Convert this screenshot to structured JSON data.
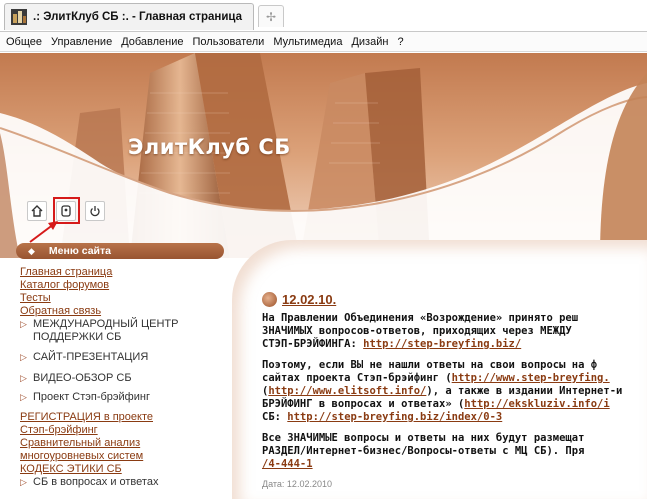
{
  "browser": {
    "tab_title": ".: ЭлитКлуб СБ :. - Главная страница",
    "new_tab_icon": "plus-icon"
  },
  "menu": [
    "Общее",
    "Управление",
    "Добавление",
    "Пользователи",
    "Мультимедиа",
    "Дизайн",
    "?"
  ],
  "site": {
    "title": "ЭлитКлуб СБ",
    "sitemenu_label": "Меню сайта"
  },
  "nav": {
    "l1": "Главная страница",
    "l2": "Каталог форумов",
    "l3": "Тесты",
    "l4": "Обратная связь",
    "s1a": "МЕЖДУНАРОДНЫЙ ЦЕНТР",
    "s1b": "ПОДДЕРЖКИ СБ",
    "s2": "САЙТ-ПРЕЗЕНТАЦИЯ",
    "s3": "ВИДЕО-ОБЗОР СБ",
    "s4": "Проект Стэп-брэйфинг",
    "l5": "РЕГИСТРАЦИЯ в проекте",
    "l6": "Стэп-брэйфинг",
    "l7": "Сравнительный анализ",
    "l8": "многоуровневых систем",
    "l9": "КОДЕКС ЭТИКИ СБ",
    "s5": "СБ в вопросах и ответах"
  },
  "news": {
    "date": "12.02.10.",
    "p1a": "На Правлении Объединения «Возрождение» принято реш",
    "p1b": "ЗНАЧИМЫХ вопросов-ответов, приходящих через МЕЖДУ",
    "p1c_text": "СТЭП-БРЭЙФИНГА: ",
    "p1c_link": "http://step-breyfing.biz/",
    "p2a": "Поэтому, если ВЫ не нашли ответы на свои вопросы на ф",
    "p2b_text": "сайтах проекта Стэп-брэйфинг (",
    "p2b_link": "http://www.step-breyfing.",
    "p2c_link": "http://www.elitsoft.info/",
    "p2c_text": "), а также в издании Интернет-и",
    "p2d_text": "БРЭЙФИНГ в вопросах и ответах» (",
    "p2d_link": "http://ekskluziv.info/i",
    "p2e_text": "СБ: ",
    "p2e_link": "http://step-breyfing.biz/index/0-3",
    "p3a": "Все ЗНАЧИМЫЕ вопросы и ответы на них будут размещат",
    "p3b": "РАЗДЕЛ/Интернет-бизнес/Вопросы-ответы с МЦ СБ). Пря",
    "p3c_link": "/4-444-1",
    "meta": "Дата: 12.02.2010"
  },
  "colors": {
    "accent": "#8a3b12",
    "highlight": "#d61a1a",
    "banner": "#cc8d62"
  }
}
